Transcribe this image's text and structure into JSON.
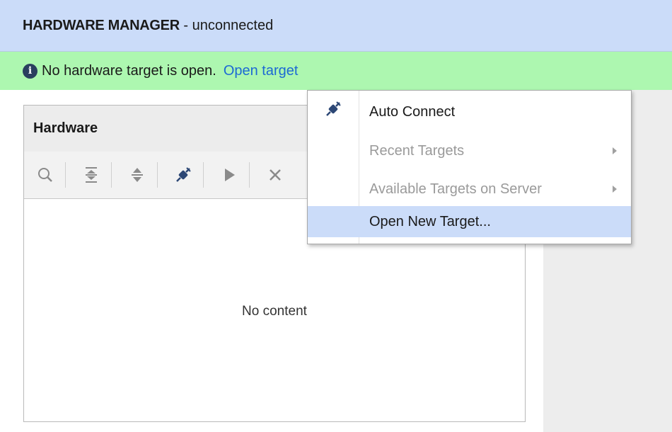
{
  "header": {
    "title_bold": "HARDWARE MANAGER",
    "title_rest": " - unconnected"
  },
  "infobar": {
    "icon": "info-icon",
    "message": "No hardware target is open.",
    "link": "Open target"
  },
  "panel": {
    "title": "Hardware",
    "toolbar": [
      "search-icon",
      "collapse-all-icon",
      "expand-all-icon",
      "auto-connect-icon",
      "run-icon",
      "close-icon"
    ],
    "empty_text": "No content"
  },
  "menu": {
    "items": [
      {
        "label": "Auto Connect",
        "icon": "auto-connect-icon",
        "enabled": true
      },
      {
        "label": "Recent Targets",
        "enabled": false,
        "submenu": true
      },
      {
        "label": "Available Targets on Server",
        "enabled": false,
        "submenu": true
      },
      {
        "label": "Open New Target...",
        "enabled": true,
        "highlighted": true
      }
    ]
  },
  "colors": {
    "title_bar": "#cbdcf9",
    "info_bar": "#adf7b0",
    "link": "#1c69d4",
    "menu_highlight": "#cbdcf9"
  }
}
